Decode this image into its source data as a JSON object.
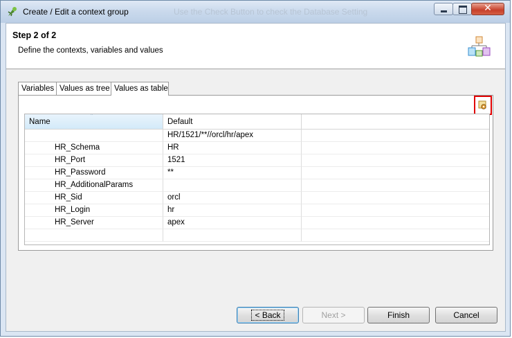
{
  "window": {
    "title": "Create / Edit a context group",
    "ghost_title": "Use the Check Button to check the Database Setting",
    "controls": {
      "minimize": "minimize",
      "maximize": "maximize",
      "close": "✕"
    }
  },
  "header": {
    "step": "Step 2 of 2",
    "description": "Define the contexts, variables and values"
  },
  "tabs": [
    {
      "label": "Variables"
    },
    {
      "label": "Values as tree"
    },
    {
      "label": "Values as table"
    }
  ],
  "active_tab": "Values as table",
  "table": {
    "columns": [
      "Name",
      "Default",
      ""
    ],
    "sort_indicator": "ˆ",
    "rows": [
      {
        "name": "",
        "value": "HR/1521/**//orcl/hr/apex"
      },
      {
        "name": "HR_Schema",
        "value": "HR"
      },
      {
        "name": "HR_Port",
        "value": "1521"
      },
      {
        "name": "HR_Password",
        "value": "**"
      },
      {
        "name": "HR_AdditionalParams",
        "value": ""
      },
      {
        "name": "HR_Sid",
        "value": "orcl"
      },
      {
        "name": "HR_Login",
        "value": "hr"
      },
      {
        "name": "HR_Server",
        "value": "apex"
      },
      {
        "name": "",
        "value": ""
      }
    ]
  },
  "buttons": {
    "back": "< Back",
    "next": "Next >",
    "finish": "Finish",
    "cancel": "Cancel"
  },
  "colors": {
    "highlight_box": "#e00000",
    "header_selected": "#d3eaf9"
  }
}
